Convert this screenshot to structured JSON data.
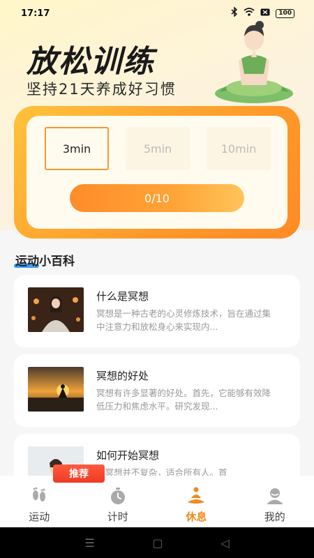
{
  "status": {
    "time": "17:17",
    "battery": "100"
  },
  "hero": {
    "title": "放松训练",
    "subtitle": "坚持21天养成好习惯"
  },
  "timer": {
    "options": [
      "3min",
      "5min",
      "10min"
    ],
    "selected_index": 0,
    "progress_text": "0/10"
  },
  "section": {
    "title": "运动小百科"
  },
  "articles": [
    {
      "title": "什么是冥想",
      "desc": "冥想是一种古老的心灵修炼技术，旨在通过集中注意力和放松身心来实现内..."
    },
    {
      "title": "冥想的好处",
      "desc": "冥想有许多显著的好处。首先，它能够有效降低压力和焦虑水平。研究发现..."
    },
    {
      "title": "如何开始冥想",
      "desc": "始冥想并不复杂，适合所有人。首"
    }
  ],
  "badge": "推荐",
  "tabs": [
    {
      "label": "运动",
      "icon": "footprints-icon"
    },
    {
      "label": "计时",
      "icon": "timer-icon"
    },
    {
      "label": "休息",
      "icon": "meditation-icon"
    },
    {
      "label": "我的",
      "icon": "user-icon"
    }
  ],
  "active_tab": 2,
  "colors": {
    "accent": "#f08a1d",
    "card_gradient_start": "#ffc23a",
    "card_gradient_end": "#ff8a24",
    "badge": "#ee3b24"
  }
}
